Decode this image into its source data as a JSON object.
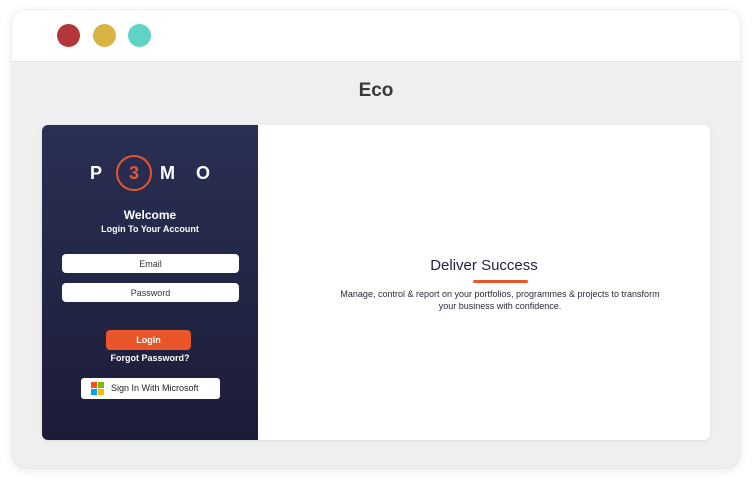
{
  "app": {
    "title": "Eco"
  },
  "window_controls": {
    "close_color": "#b5363a",
    "minimize_color": "#d9b445",
    "maximize_color": "#5fd3c4"
  },
  "logo": {
    "letters": [
      "P",
      "3",
      "M",
      "O"
    ],
    "accent_color": "#e8562a"
  },
  "login": {
    "welcome": "Welcome",
    "subtitle": "Login To Your Account",
    "email_placeholder": "Email",
    "password_placeholder": "Password",
    "login_label": "Login",
    "forgot_label": "Forgot Password?",
    "microsoft_label": "Sign In With Microsoft",
    "microsoft_icon": "microsoft-logo-icon"
  },
  "promo": {
    "title": "Deliver Success",
    "description": "Manage, control & report on your portfolios, programmes & projects to transform your business with confidence."
  },
  "colors": {
    "panel_dark": "#232645",
    "accent": "#e8562a"
  }
}
